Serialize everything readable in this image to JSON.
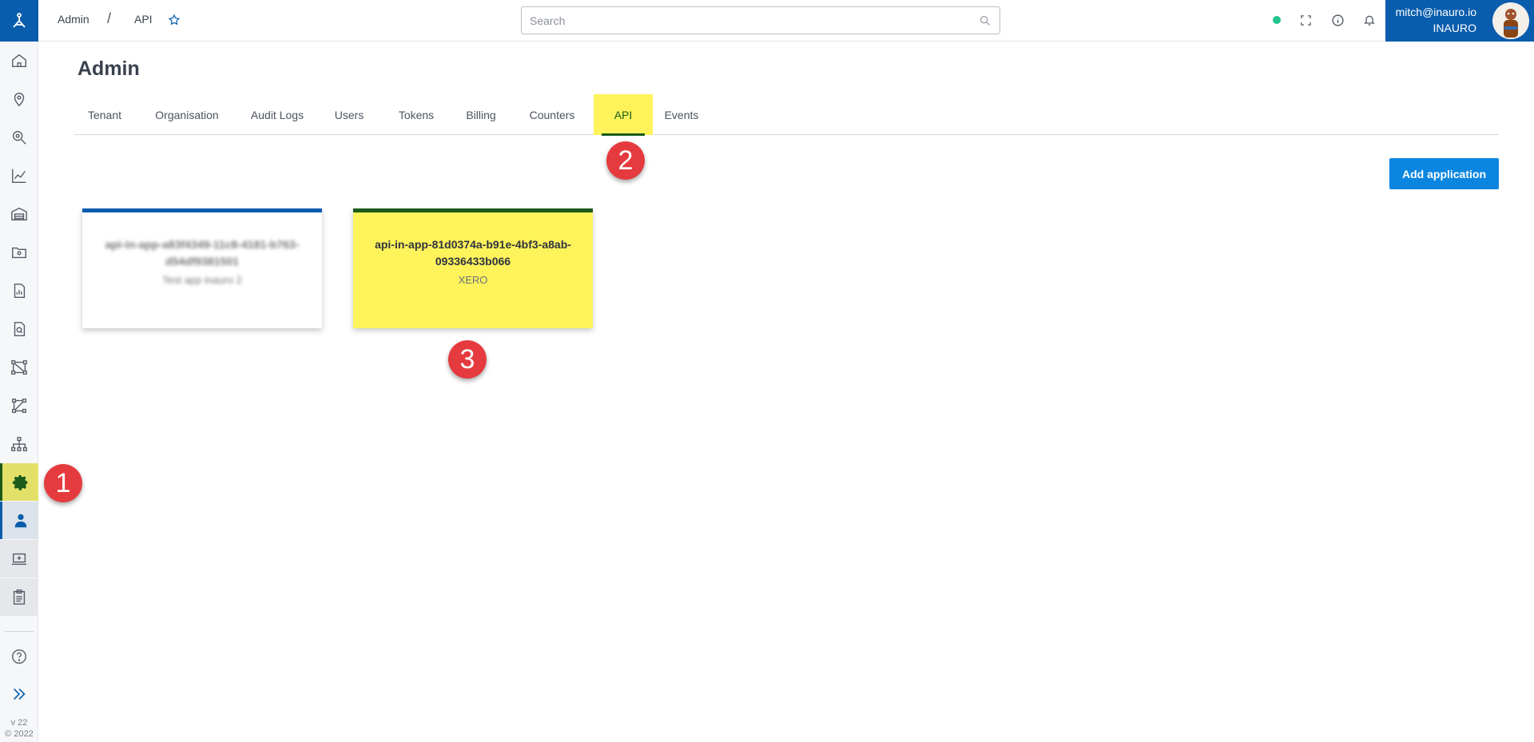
{
  "breadcrumb": {
    "items": [
      "Admin",
      "API"
    ],
    "separator": "/"
  },
  "search": {
    "placeholder": "Search"
  },
  "user": {
    "email": "mitch@inauro.io",
    "org": "INAURO"
  },
  "sidebar": {
    "items": [
      {
        "icon": "home-icon"
      },
      {
        "icon": "location-pin-icon"
      },
      {
        "icon": "search-location-icon"
      },
      {
        "icon": "line-chart-icon"
      },
      {
        "icon": "warehouse-icon"
      },
      {
        "icon": "folder-settings-icon"
      },
      {
        "icon": "report-icon"
      },
      {
        "icon": "document-search-icon"
      },
      {
        "icon": "network-icon"
      },
      {
        "icon": "workflow-icon"
      },
      {
        "icon": "hierarchy-icon"
      },
      {
        "icon": "gear-icon"
      },
      {
        "icon": "user-icon"
      },
      {
        "icon": "laptop-plus-icon"
      },
      {
        "icon": "clipboard-icon"
      },
      {
        "icon": "help-icon"
      },
      {
        "icon": "expand-icon"
      }
    ],
    "version": "v 22",
    "copyright": "© 2022"
  },
  "page": {
    "title": "Admin"
  },
  "tabs": [
    "Tenant",
    "Organisation",
    "Audit Logs",
    "Users",
    "Tokens",
    "Billing",
    "Counters",
    "API",
    "Events"
  ],
  "active_tab": "API",
  "actions": {
    "add_application": "Add application"
  },
  "cards": [
    {
      "title": "api-in-app-a83f4349-11c8-4181-b763-d54df9381501",
      "subtitle": "Test app inauro 2",
      "blurred": true,
      "accent": "#0a5dad"
    },
    {
      "title": "api-in-app-81d0374a-b91e-4bf3-a8ab-09336433b066",
      "subtitle": "XERO",
      "blurred": false,
      "accent": "#1a5b1a"
    }
  ],
  "annotations": [
    "1",
    "2",
    "3"
  ],
  "colors": {
    "brand_blue": "#0a5dad",
    "button_blue": "#0b86e0",
    "highlight_yellow": "#fef35a",
    "active_green": "#1a5b1a",
    "badge_red": "#e53b3f",
    "status_green": "#21c58e"
  }
}
